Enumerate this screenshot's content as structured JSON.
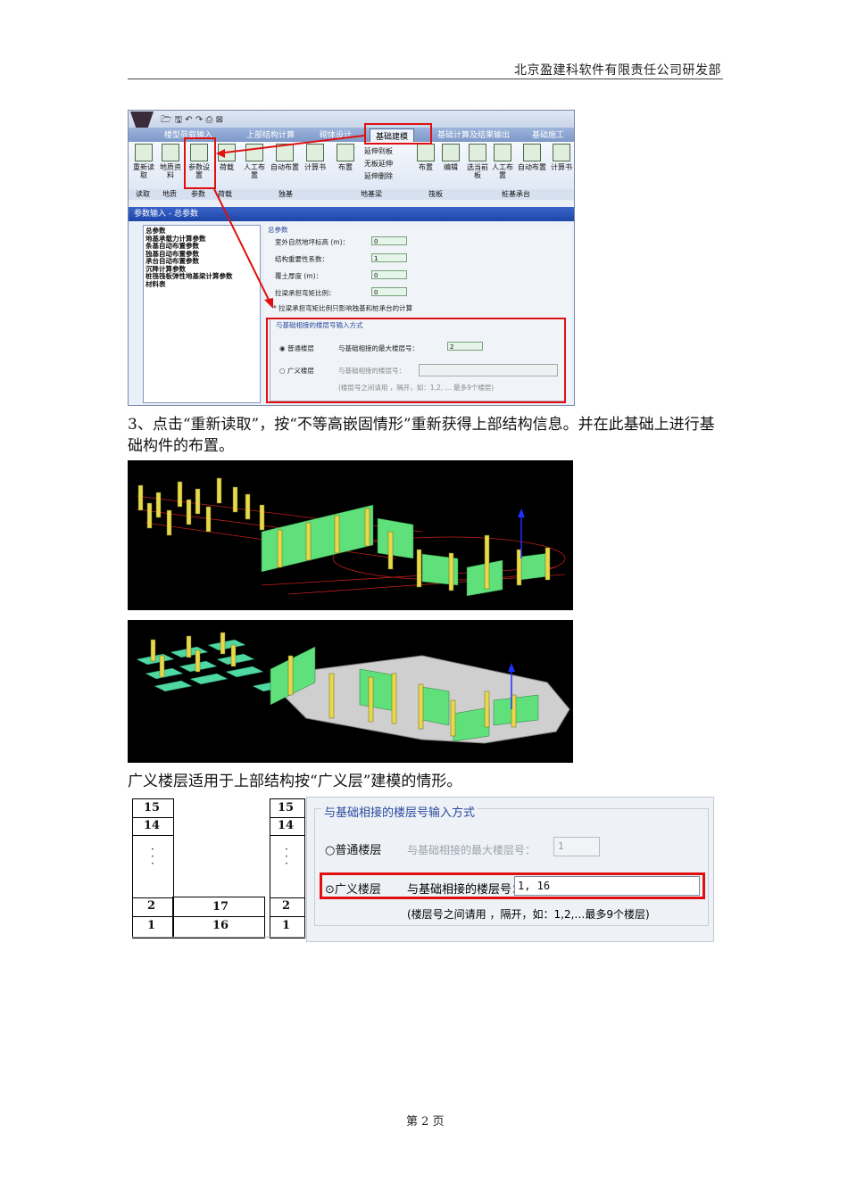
{
  "header": {
    "company": "北京盈建科软件有限责任公司研发部"
  },
  "screenshot1": {
    "tabs": [
      "楼型荷载输入",
      "上部结构计算",
      "砌体设计",
      "基础建模",
      "基础计算及结果输出",
      "基础施工"
    ],
    "ribbon_buttons": [
      "重新读取",
      "地质资料",
      "参数设置",
      "荷载",
      "人工布置",
      "自动布置",
      "计算书",
      "布置",
      "延伸到板",
      "无板延伸",
      "延伸删除",
      "布置",
      "编辑",
      "选当前板",
      "人工布置",
      "自动布置",
      "计算书"
    ],
    "ribbon_groups": [
      "读取",
      "地质",
      "参数",
      "荷载",
      "独基",
      "地基梁",
      "筏板",
      "桩基承台"
    ],
    "panel_title": "参数输入 - 总参数",
    "left_items": [
      "总参数",
      "地基承载力计算参数",
      "条基自动布置参数",
      "独基自动布置参数",
      "承台自动布置参数",
      "沉降计算参数",
      "桩筏筏板弹性地基梁计算参数",
      "材料表"
    ],
    "section_title": "总参数",
    "fields": [
      {
        "label": "室外自然地坪标高 (m)：",
        "value": "0"
      },
      {
        "label": "结构重要性系数：",
        "value": "1"
      },
      {
        "label": "覆土厚度 (m)：",
        "value": "0"
      },
      {
        "label": "拉梁承担弯矩比例：",
        "value": "0"
      }
    ],
    "note": "* 拉梁承担弯矩比例只影响独基和桩承台的计算",
    "floor_group_title": "与基础相接的楼层号输入方式",
    "opt_normal": "普通楼层",
    "opt_normal_label": "与基础相接的最大楼层号：",
    "opt_normal_value": "2",
    "opt_general": "广义楼层",
    "opt_general_label": "与基础相接的楼层号：",
    "opt_general_hint": "(楼层号之间请用 ，隔开，如：1,2, ... 最多9个楼层)"
  },
  "para1": "3、点击“重新读取”，按“不等高嵌固情形”重新获得上部结构信息。并在此基础上进行基础构件的布置。",
  "para2": "广义楼层适用于上部结构按“广义层”建模的情形。",
  "figure3": {
    "left_floors": [
      "15",
      "14",
      "2",
      "1"
    ],
    "mid_floors": [
      "17",
      "16"
    ],
    "right_floors": [
      "15",
      "14",
      "2",
      "1"
    ],
    "dlg_title": "与基础相接的楼层号输入方式",
    "opt_normal": "普通楼层",
    "normal_label": "与基础相接的最大楼层号：",
    "normal_value": "1",
    "opt_general": "广义楼层",
    "general_label": "与基础相接的楼层号：",
    "general_value": "1, 16",
    "hint": "(楼层号之间请用 ，隔开，如：1,2,…最多9个楼层)"
  },
  "footer": {
    "page": "第 2 页"
  },
  "colors": {
    "accent_red": "#e01010",
    "wall_green": "#5fe07a",
    "column_yellow": "#e8d84a",
    "grid_red": "#c0201e"
  }
}
